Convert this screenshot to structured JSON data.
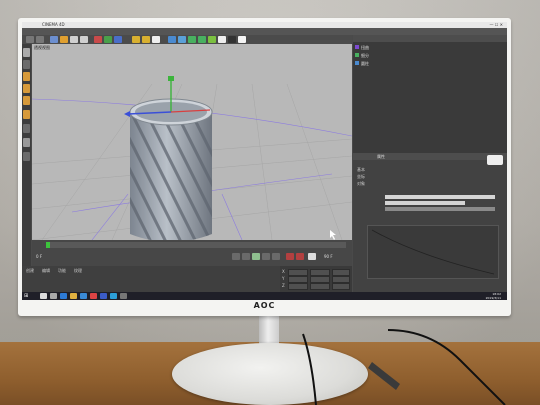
{
  "monitor": {
    "brand": "AOC"
  },
  "app": {
    "title": "CINEMA 4D",
    "window_controls": "—  ☐  ✕",
    "menu_items": [
      "文件",
      "编辑",
      "创建",
      "选择",
      "工具",
      "网格",
      "捕捉",
      "动画",
      "模拟",
      "渲染",
      "雕刻",
      "运动跟踪",
      "运动图形",
      "角色",
      "流水线",
      "插件",
      "脚本",
      "窗口",
      "帮助"
    ],
    "viewport_label": "透视视图",
    "object_manager": {
      "rows": [
        "扭曲",
        "细分",
        "圆柱"
      ]
    },
    "attribute_manager": {
      "tab": "属性",
      "rows": [
        "基本",
        "坐标",
        "对象"
      ]
    },
    "timeline": {
      "frame_readout": "0 F",
      "end_frame": "90 F"
    },
    "material_menu": [
      "创建",
      "编辑",
      "功能",
      "纹理"
    ],
    "coordinate_labels": [
      "X",
      "Y",
      "Z"
    ],
    "coordinate_values": [
      "0 cm",
      "0 cm",
      "0 cm"
    ]
  },
  "taskbar": {
    "start_icon": "windows-logo-icon",
    "time": "18:02",
    "date": "2019/3/11"
  },
  "colors": {
    "viewport": "#b8b8b8",
    "ui_dark": "#3f3f3f",
    "object": "#9aa3ad",
    "desk": "#8f5f2e"
  }
}
